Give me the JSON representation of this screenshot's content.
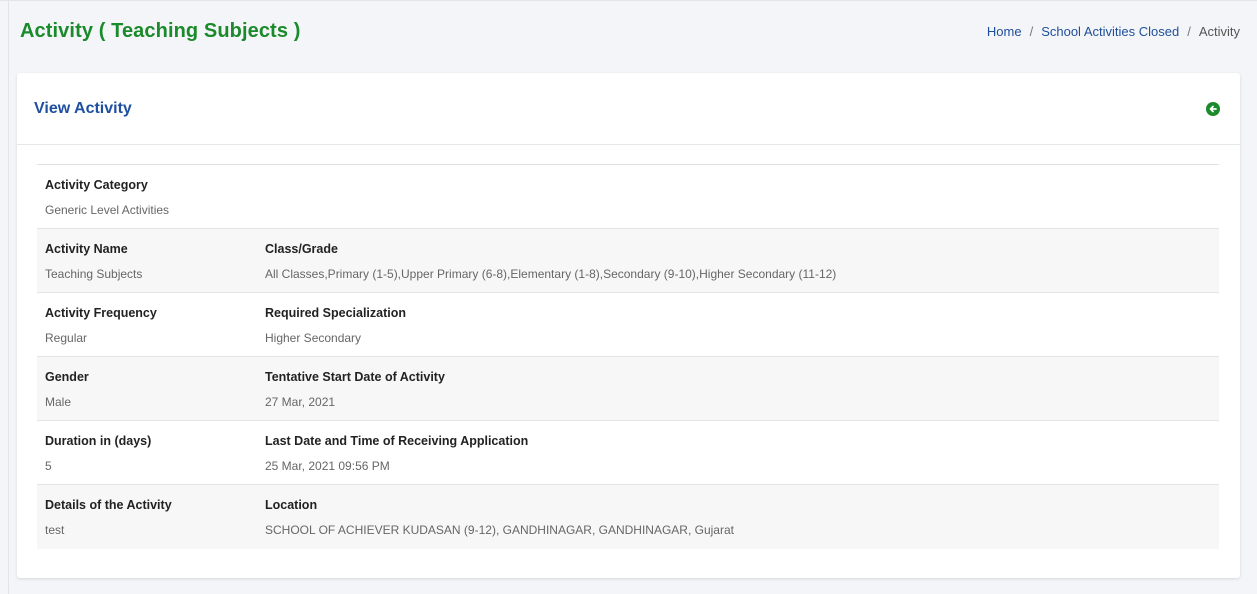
{
  "header": {
    "title": "Activity ( Teaching Subjects )",
    "breadcrumb": {
      "home": "Home",
      "section": "School Activities Closed",
      "current": "Activity",
      "separator": "/"
    }
  },
  "card": {
    "title": "View Activity",
    "back_icon": "circle-arrow-left-icon",
    "accent_color": "#1a8a2b"
  },
  "details": {
    "activity_category": {
      "label": "Activity Category",
      "value": "Generic Level Activities"
    },
    "activity_name": {
      "label": "Activity Name",
      "value": "Teaching Subjects"
    },
    "class_grade": {
      "label": "Class/Grade",
      "value": "All Classes,Primary (1-5),Upper Primary (6-8),Elementary (1-8),Secondary (9-10),Higher Secondary (11-12)"
    },
    "activity_frequency": {
      "label": "Activity Frequency",
      "value": "Regular"
    },
    "required_specialization": {
      "label": "Required Specialization",
      "value": "Higher Secondary"
    },
    "gender": {
      "label": "Gender",
      "value": "Male"
    },
    "tentative_start_date": {
      "label": "Tentative Start Date of Activity",
      "value": "27 Mar, 2021"
    },
    "duration": {
      "label": "Duration in (days)",
      "value": "5"
    },
    "last_date": {
      "label": "Last Date and Time of Receiving Application",
      "value": "25 Mar, 2021 09:56 PM"
    },
    "details_of_activity": {
      "label": "Details of the Activity",
      "value": "test"
    },
    "location": {
      "label": "Location",
      "value": "SCHOOL OF ACHIEVER KUDASAN (9-12), GANDHINAGAR, GANDHINAGAR, Gujarat"
    }
  }
}
